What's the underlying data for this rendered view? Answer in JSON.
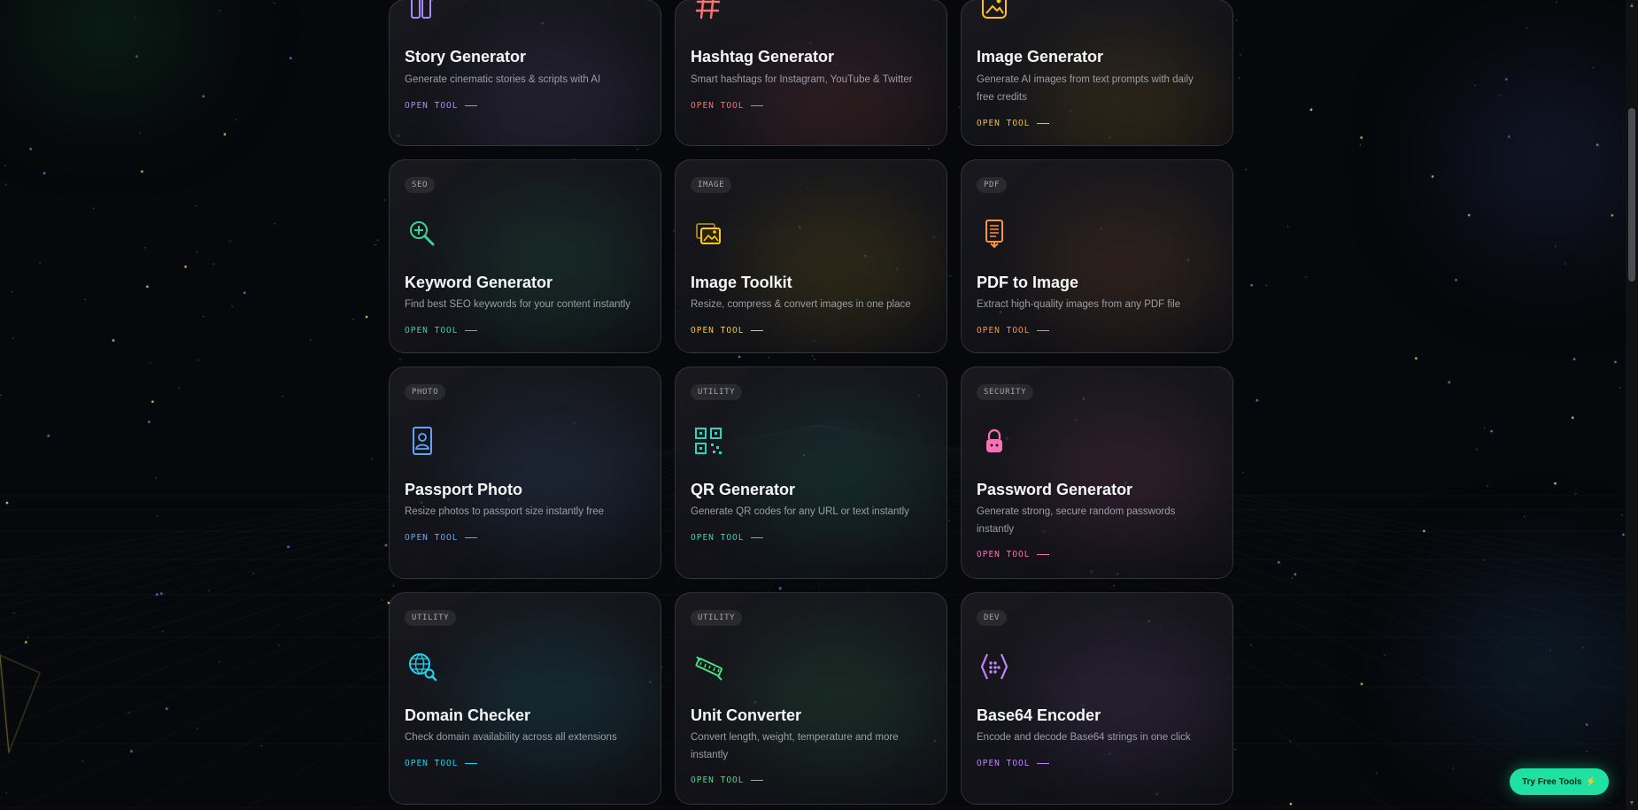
{
  "tools": [
    {
      "badge": "",
      "icon": "story-icon",
      "title": "Story Generator",
      "desc": "Generate cinematic stories & scripts with AI",
      "open": "OPEN TOOL",
      "accent": "#a78bfa"
    },
    {
      "badge": "",
      "icon": "hashtag-icon",
      "title": "Hashtag Generator",
      "desc": "Smart hashtags for Instagram, YouTube & Twitter",
      "open": "OPEN TOOL",
      "accent": "#f87171"
    },
    {
      "badge": "",
      "icon": "image-icon",
      "title": "Image Generator",
      "desc": "Generate AI images from text prompts with daily free credits",
      "open": "OPEN TOOL",
      "accent": "#fbbf24"
    },
    {
      "badge": "SEO",
      "icon": "magnifier-plus-icon",
      "title": "Keyword Generator",
      "desc": "Find best SEO keywords for your content instantly",
      "open": "OPEN TOOL",
      "accent": "#34d399"
    },
    {
      "badge": "IMAGE",
      "icon": "image-stack-icon",
      "title": "Image Toolkit",
      "desc": "Resize, compress & convert images in one place",
      "open": "OPEN TOOL",
      "accent": "#facc15"
    },
    {
      "badge": "PDF",
      "icon": "pdf-download-icon",
      "title": "PDF to Image",
      "desc": "Extract high-quality images from any PDF file",
      "open": "OPEN TOOL",
      "accent": "#fb923c"
    },
    {
      "badge": "PHOTO",
      "icon": "passport-icon",
      "title": "Passport Photo",
      "desc": "Resize photos to passport size instantly free",
      "open": "OPEN TOOL",
      "accent": "#60a5fa"
    },
    {
      "badge": "UTILITY",
      "icon": "qr-code-icon",
      "title": "QR Generator",
      "desc": "Generate QR codes for any URL or text instantly",
      "open": "OPEN TOOL",
      "accent": "#2dd4bf"
    },
    {
      "badge": "SECURITY",
      "icon": "lock-icon",
      "title": "Password Generator",
      "desc": "Generate strong, secure random passwords instantly",
      "open": "OPEN TOOL",
      "accent": "#f472b6"
    },
    {
      "badge": "UTILITY",
      "icon": "globe-search-icon",
      "title": "Domain Checker",
      "desc": "Check domain availability across all extensions",
      "open": "OPEN TOOL",
      "accent": "#22d3ee"
    },
    {
      "badge": "UTILITY",
      "icon": "ruler-icon",
      "title": "Unit Converter",
      "desc": "Convert length, weight, temperature and more instantly",
      "open": "OPEN TOOL",
      "accent": "#4ade80"
    },
    {
      "badge": "DEV",
      "icon": "code-brackets-icon",
      "title": "Base64 Encoder",
      "desc": "Encode and decode Base64 strings in one click",
      "open": "OPEN TOOL",
      "accent": "#c084fc"
    }
  ],
  "cta": {
    "label": "Try Free Tools",
    "emoji": "⚡",
    "color": "#20e0a2"
  }
}
